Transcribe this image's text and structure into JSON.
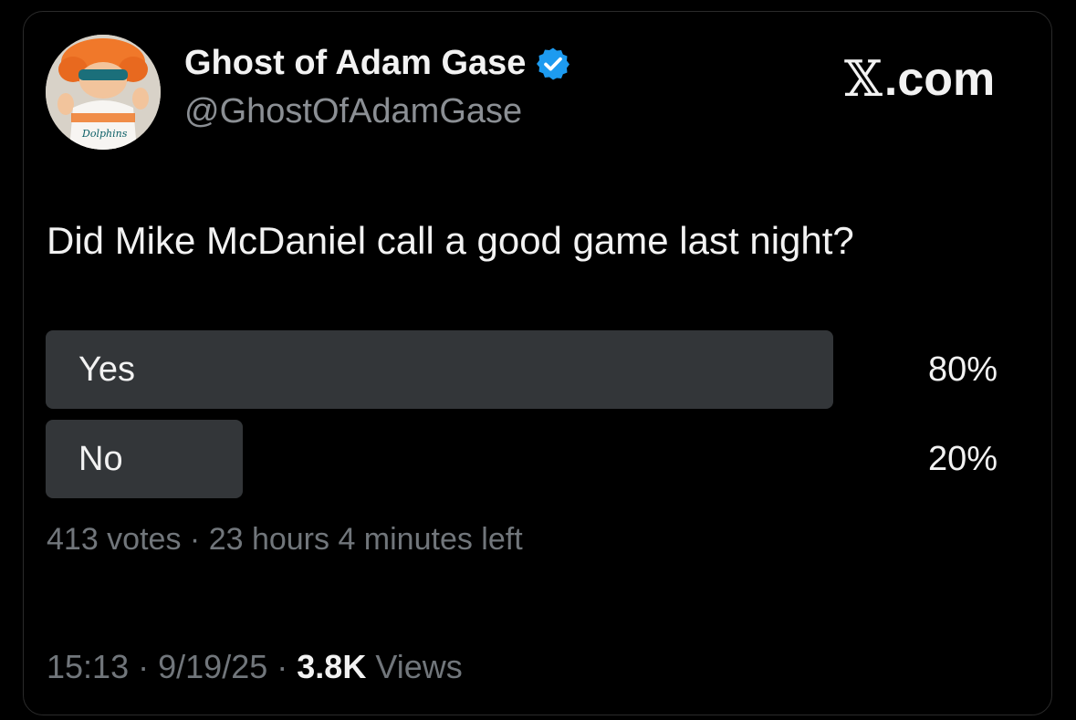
{
  "tweet": {
    "author": {
      "display_name": "Ghost of Adam Gase",
      "handle": "@GhostOfAdamGase",
      "verified_icon": "verified-badge-icon",
      "avatar_text": "Dolphins"
    },
    "brand": {
      "logo_glyph": "𝕏",
      "logo_suffix": ".com"
    },
    "question": "Did Mike McDaniel call a good game last night?",
    "poll": {
      "options": [
        {
          "label": "Yes",
          "percent_text": "80%",
          "percent": 80
        },
        {
          "label": "No",
          "percent_text": "20%",
          "percent": 20
        }
      ],
      "votes": "413 votes",
      "separator": "·",
      "time_left": "23 hours 4 minutes left"
    },
    "footer": {
      "time": "15:13",
      "date": "9/19/25",
      "views_count": "3.8K",
      "views_label": "Views",
      "separator": "·"
    }
  },
  "colors": {
    "background": "#000000",
    "bar": "#333639",
    "verified": "#1d9bf0",
    "muted": "#71767b"
  }
}
